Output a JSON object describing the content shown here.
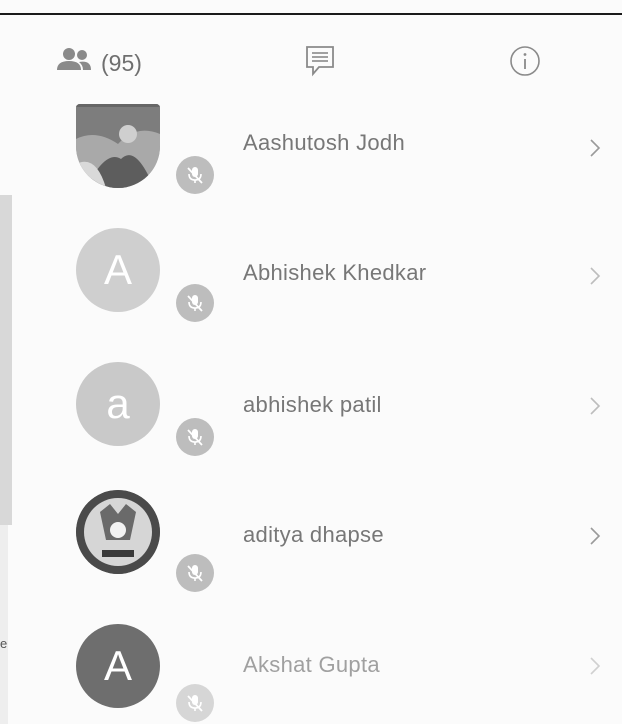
{
  "tabs": {
    "participants_count": "(95)",
    "participants_icon": "people-icon",
    "chat_icon": "chat-icon",
    "info_icon": "info-icon"
  },
  "participants": [
    {
      "name": "Aashutosh Jodh",
      "avatar_type": "photo",
      "avatar_letter": "",
      "muted": true
    },
    {
      "name": "Abhishek Khedkar",
      "avatar_type": "letter",
      "avatar_letter": "A",
      "avatar_color": "#cfcfcf",
      "muted": true
    },
    {
      "name": "abhishek patil",
      "avatar_type": "letter",
      "avatar_letter": "a",
      "avatar_color": "#c9c9c9",
      "muted": true
    },
    {
      "name": "aditya dhapse",
      "avatar_type": "photo",
      "avatar_letter": "",
      "muted": true
    },
    {
      "name": "Akshat Gupta",
      "avatar_type": "letter",
      "avatar_letter": "A",
      "avatar_color": "#6e6e6e",
      "muted": true
    }
  ],
  "colors": {
    "text": "#777777",
    "icon": "#8a8a8a",
    "mute_bg": "#bdbdbd"
  }
}
